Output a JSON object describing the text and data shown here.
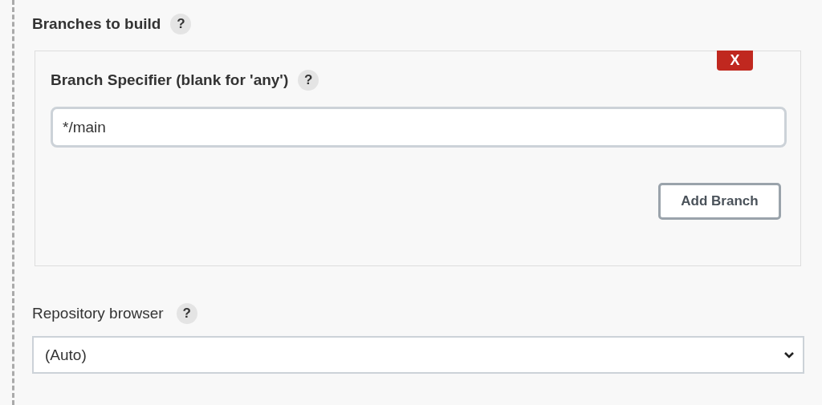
{
  "branches_section": {
    "title": "Branches to build",
    "help": "?",
    "branch": {
      "delete_button": "X",
      "label": "Branch Specifier (blank for 'any')",
      "help": "?",
      "value": "*/main"
    },
    "add_button": "Add Branch"
  },
  "repository_browser": {
    "label": "Repository browser",
    "help": "?",
    "value": "(Auto)"
  }
}
